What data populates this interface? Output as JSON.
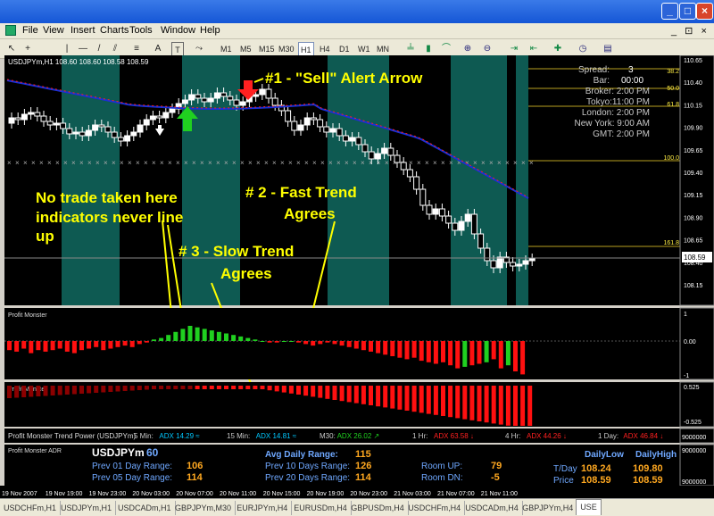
{
  "window": {
    "minimize": "_",
    "maximize": "□",
    "close": "×"
  },
  "menu": [
    "File",
    "View",
    "Insert",
    "Charts",
    "Tools",
    "Window",
    "Help"
  ],
  "mdi_controls": "_ ⊡ ×",
  "timeframes": [
    "M1",
    "M5",
    "M15",
    "M30",
    "H1",
    "H4",
    "D1",
    "W1",
    "MN"
  ],
  "active_timeframe": "H1",
  "chart": {
    "header": "USDJPYm,H1  108.60 108.60 108.58 108.59",
    "info": {
      "spread_label": "Spread:",
      "spread_value": "3",
      "bar_label": "Bar:",
      "bar_value": "00:00",
      "broker": "Broker:  2:00 PM",
      "tokyo": "Tokyo:11:00 PM",
      "london": "London:  2:00 PM",
      "newyork": "New York:  9:00 AM",
      "gmt": "GMT:  2:00 PM"
    },
    "fib": {
      "f382": "38.2",
      "f500": "50.0",
      "f618": "61.8",
      "f1000": "100.0",
      "f1618": "161.8"
    },
    "price_axis": [
      "110.65",
      "110.40",
      "110.15",
      "109.90",
      "109.65",
      "109.40",
      "109.15",
      "108.90",
      "108.65",
      "108.40",
      "108.15"
    ],
    "current_price": "108.59",
    "annotations": {
      "sell_alert": "#1 - \"Sell\" Alert Arrow",
      "no_trade": [
        "No trade taken here",
        "indicators never line",
        "up"
      ],
      "fast_trend": [
        "# 2 - Fast Trend",
        "Agrees"
      ],
      "slow_trend": [
        "# 3 - Slow Trend",
        "Agrees"
      ]
    },
    "colors": {
      "background": "#000000",
      "session": "#0e5a52",
      "bull": "#ffffff",
      "bear": "#000000",
      "ma_slow": "#1a2fd6",
      "ma_fast": "#ff2020",
      "annotation": "#ffff00",
      "sell_arrow": "#ff2020",
      "buy_arrow": "#20d020",
      "hist_up": "#20d020",
      "hist_down": "#ff1010",
      "hist_dark": "#8b0000"
    }
  },
  "fast_indicator": {
    "title": "Profit Monster",
    "axis": [
      "1",
      "0.00",
      "-1"
    ]
  },
  "slow_indicator": {
    "title": "Profit Monster",
    "axis": [
      "0.525",
      "-0.525"
    ]
  },
  "trend_power": {
    "title": "Profit Monster Trend Power (USDJPYm)",
    "items": [
      {
        "label": "5 Min:",
        "adx": "ADX 14.29",
        "arrow": "≈",
        "color": "#00c8ff"
      },
      {
        "label": "15 Min:",
        "adx": "ADX 14.81",
        "arrow": "≈",
        "color": "#00c8ff"
      },
      {
        "label": "M30:",
        "adx": "ADX 26.02",
        "arrow": "↗",
        "color": "#20d020"
      },
      {
        "label": "1 Hr:",
        "adx": "ADX 63.58",
        "arrow": "↓",
        "color": "#ff2020"
      },
      {
        "label": "4 Hr:",
        "adx": "ADX 44.26",
        "arrow": "↓",
        "color": "#ff2020"
      },
      {
        "label": "1 Day:",
        "adx": "ADX 46.84",
        "arrow": "↓",
        "color": "#ff2020"
      }
    ],
    "axis": "9000000"
  },
  "adr": {
    "title": "Profit Monster ADR",
    "symbol": "USDJPYm",
    "period": "60",
    "prev1_label": "Prev 01 Day Range:",
    "prev1": "106",
    "prev5_label": "Prev 05 Day Range:",
    "prev5": "114",
    "avg_label": "Avg Daily Range:",
    "avg": "115",
    "prev10_label": "Prev 10 Days Range:",
    "prev10": "126",
    "prev20_label": "Prev 20 Days Range:",
    "prev20": "114",
    "room_up_label": "Room UP:",
    "room_up": "79",
    "room_dn_label": "Room DN:",
    "room_dn": "-5",
    "daily_low_h": "DailyLow",
    "daily_high_h": "DailyHigh",
    "tday_label": "T/Day",
    "tday_low": "108.24",
    "tday_high": "109.80",
    "price_label": "Price",
    "price_low": "108.59",
    "price_high": "108.59",
    "axis_top": "9000000",
    "axis_bottom": "9000000"
  },
  "time_axis": [
    "19 Nov 2007",
    "19 Nov 19:00",
    "19 Nov 23:00",
    "20 Nov 03:00",
    "20 Nov 07:00",
    "20 Nov 11:00",
    "20 Nov 15:00",
    "20 Nov 19:00",
    "20 Nov 23:00",
    "21 Nov 03:00",
    "21 Nov 07:00",
    "21 Nov 11:00"
  ],
  "tabs": [
    "USDCHFm,H1",
    "USDJPYm,H1",
    "USDCADm,H1",
    "GBPJPYm,M30",
    "EURJPYm,H4",
    "EURUSDm,H4",
    "GBPUSDm,H4",
    "USDCHFm,H4",
    "USDCADm,H4",
    "GBPJPYm,H4",
    "USE"
  ],
  "active_tab": 10
}
